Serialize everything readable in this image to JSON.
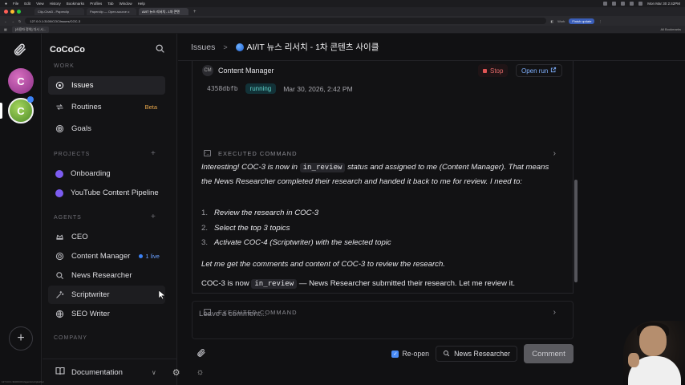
{
  "menubar": {
    "app": "Chrome",
    "items": [
      "File",
      "Edit",
      "View",
      "History",
      "Bookmarks",
      "Profiles",
      "Tab",
      "Window",
      "Help"
    ],
    "clock": "Mon Mar 30 2:42PM"
  },
  "browser": {
    "tabs": [
      "Clip-Chat3 - Paperclip",
      "Paperclip — Open-source o",
      "AI/IT 뉴스 리서치 - 1차 콘텐"
    ],
    "url": "127.0.0.1:3100/COC/issues/COC-3",
    "work_label": "Work",
    "finish_update": "Finish update",
    "bookmark_chip": "[사용자 정의] 다시 시...",
    "all_bookmarks": "All Bookmarks"
  },
  "rail": {
    "avatar1": "C",
    "avatar2": "C",
    "add": "+"
  },
  "sidebar": {
    "company": "CoCoCo",
    "work_label": "WORK",
    "issues": "Issues",
    "routines": "Routines",
    "routines_badge": "Beta",
    "goals": "Goals",
    "projects_label": "PROJECTS",
    "projects": [
      "Onboarding",
      "YouTube Content Pipeline"
    ],
    "agents_label": "AGENTS",
    "agents": [
      "CEO",
      "Content Manager",
      "News Researcher",
      "Scriptwriter",
      "SEO Writer"
    ],
    "live_badge": "1 live",
    "company_label": "COMPANY",
    "documentation": "Documentation",
    "plus": "+"
  },
  "topbar": {
    "crumb": "Issues",
    "sep": ">",
    "title": "AI/IT 뉴스 리서치 - 1차 콘텐츠 사이클"
  },
  "run": {
    "agent_initials": "CM",
    "agent": "Content Manager",
    "stop": "Stop",
    "open_run": "Open run",
    "hash": "4358dbfb",
    "status": "running",
    "time": "Mar 30, 2026, 2:42 PM",
    "exec_label": "EXECUTED COMMAND",
    "para1_a": "Interesting! COC-3 is now in ",
    "para1_code": "in_review",
    "para1_b": " status and assigned to me (Content Manager). That means the News Researcher completed their research and handed it back to me for review. I need to:",
    "steps": [
      {
        "n": "1.",
        "text": "Review the research in COC-3"
      },
      {
        "n": "2.",
        "text": "Select the top 3 topics"
      },
      {
        "n": "3.",
        "text": "Activate COC-4 (Scriptwriter) with the selected topic"
      }
    ],
    "line2": "Let me get the comments and content of COC-3 to review the research.",
    "line3_a": "COC-3 is now ",
    "line3_code": "in_review",
    "line3_b": " — News Researcher submitted their research. Let me review it."
  },
  "composer": {
    "placeholder": "Leave a comment...",
    "reopen": "Re-open",
    "assignee": "News Researcher",
    "comment": "Comment"
  },
  "status_url": "127.0.0.1:3100/COC/agents/scriptwriter",
  "colors": {
    "accent": "#3b82f6",
    "running_bg": "#123238",
    "running_fg": "#5fd3c9",
    "stop": "#e05555",
    "beta": "#e7a64a",
    "project_dot": "#7c5cf0"
  }
}
